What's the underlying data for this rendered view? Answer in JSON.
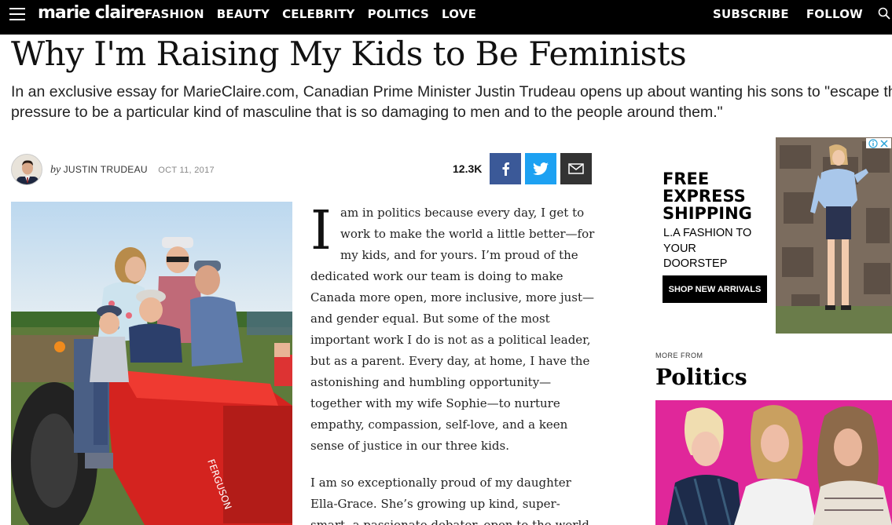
{
  "nav": {
    "logo": "marie claire",
    "items": [
      "FASHION",
      "BEAUTY",
      "CELEBRITY",
      "POLITICS",
      "LOVE"
    ],
    "subscribe": "SUBSCRIBE",
    "follow": "FOLLOW"
  },
  "article": {
    "headline": "Why I'm Raising My Kids to Be Feminists",
    "dek_line1": "In an exclusive essay for MarieClaire.com, Canadian Prime Minister Justin Trudeau opens up about wanting his sons to \"escape the",
    "dek_line2": "pressure to be a particular kind of masculine that is so damaging to men and to the people around them.\"",
    "by": "by",
    "author": "JUSTIN TRUDEAU",
    "date": "OCT 11, 2017",
    "share_count": "12.3K",
    "dropcap": "I",
    "para1_lines": [
      "am in politics because every day, I get to",
      "work to make the world a little better—for",
      "my kids, and for yours. I’m proud of the",
      "dedicated work our team is doing to make",
      "Canada more open, more inclusive, more just—",
      "and gender equal. But some of the most",
      "important work I do is not as a political leader,",
      "but as a parent. Every day, at home, I have the",
      "astonishing and humbling opportunity—",
      "together with my wife Sophie—to nurture",
      "empathy, compassion, self-love, and a keen",
      "sense of justice in our three kids."
    ],
    "para2_lines": [
      "I am so exceptionally proud of my daughter",
      "Ella-Grace. She’s growing up kind, super-",
      "smart, a passionate debater, open to the world"
    ]
  },
  "ad": {
    "title_lines": [
      "FREE",
      "EXPRESS",
      "SHIPPING"
    ],
    "sub_lines": [
      "L.A FASHION TO",
      "YOUR",
      "DOORSTEP"
    ],
    "button": "SHOP NEW ARRIVALS"
  },
  "more": {
    "label": "MORE FROM",
    "title": "Politics"
  },
  "icons": {
    "menu": "hamburger-icon",
    "search": "search-icon",
    "facebook": "facebook-icon",
    "twitter": "twitter-icon",
    "mail": "mail-icon"
  },
  "colors": {
    "facebook": "#3b5998",
    "twitter": "#1da1f2",
    "mail": "#333333",
    "nav_bg": "#000000",
    "more_bg": "#e0279a"
  }
}
